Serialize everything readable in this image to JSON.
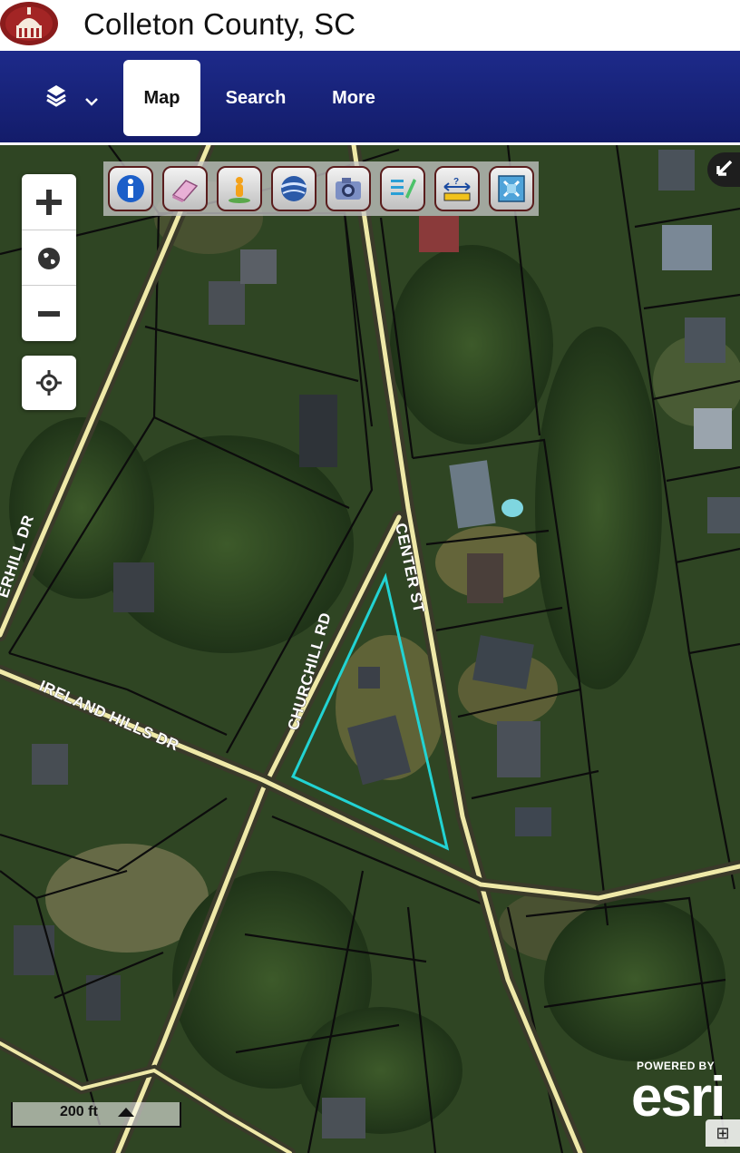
{
  "header": {
    "title": "Colleton County, SC"
  },
  "nav": {
    "tabs": [
      {
        "label": "Map",
        "active": true
      },
      {
        "label": "Search",
        "active": false
      },
      {
        "label": "More",
        "active": false
      }
    ]
  },
  "map": {
    "streets": [
      "CENTER ST",
      "CHURCHILL RD",
      "IRELAND HILLS DR",
      "ERHILL DR"
    ],
    "highlight_color": "#22d3d3",
    "scale_label": "200 ft",
    "attribution": {
      "powered_by": "POWERED BY",
      "logo": "esri"
    }
  },
  "toolbar": {
    "tools": [
      {
        "icon": "info-icon"
      },
      {
        "icon": "eraser-icon"
      },
      {
        "icon": "street-view-icon"
      },
      {
        "icon": "globe-icon"
      },
      {
        "icon": "camera-icon"
      },
      {
        "icon": "edit-list-icon"
      },
      {
        "icon": "measure-icon"
      },
      {
        "icon": "full-extent-icon"
      }
    ]
  }
}
